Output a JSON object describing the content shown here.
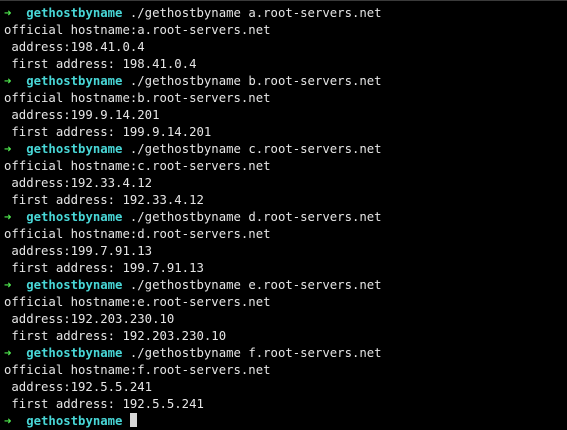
{
  "prompt": {
    "arrow": "➜",
    "directory": "gethostbyname"
  },
  "blocks": [
    {
      "command": "./gethostbyname a.root-servers.net",
      "official": "official hostname:a.root-servers.net",
      "address": " address:198.41.0.4",
      "first_address": " first address: 198.41.0.4"
    },
    {
      "command": "./gethostbyname b.root-servers.net",
      "official": "official hostname:b.root-servers.net",
      "address": " address:199.9.14.201",
      "first_address": " first address: 199.9.14.201"
    },
    {
      "command": "./gethostbyname c.root-servers.net",
      "official": "official hostname:c.root-servers.net",
      "address": " address:192.33.4.12",
      "first_address": " first address: 192.33.4.12"
    },
    {
      "command": "./gethostbyname d.root-servers.net",
      "official": "official hostname:d.root-servers.net",
      "address": " address:199.7.91.13",
      "first_address": " first address: 199.7.91.13"
    },
    {
      "command": "./gethostbyname e.root-servers.net",
      "official": "official hostname:e.root-servers.net",
      "address": " address:192.203.230.10",
      "first_address": " first address: 192.203.230.10"
    },
    {
      "command": "./gethostbyname f.root-servers.net",
      "official": "official hostname:f.root-servers.net",
      "address": " address:192.5.5.241",
      "first_address": " first address: 192.5.5.241"
    }
  ],
  "colors": {
    "background": "#000000",
    "text": "#e6e6e6",
    "prompt_arrow": "#4fe84f",
    "prompt_directory": "#48d7d7",
    "cursor": "#d9d9d9"
  }
}
